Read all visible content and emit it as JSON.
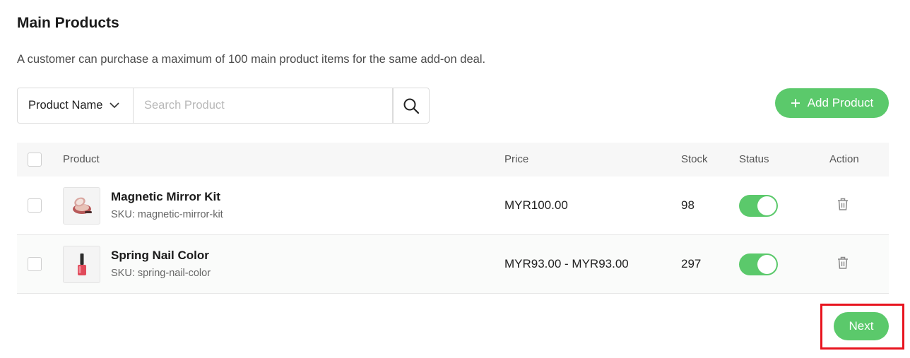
{
  "section": {
    "title": "Main Products",
    "description": "A customer can purchase a maximum of 100 main product items for the same add-on deal."
  },
  "search": {
    "field_selected": "Product Name",
    "placeholder": "Search Product",
    "value": ""
  },
  "add_button": {
    "icon": "plus-icon",
    "label": "Add Product"
  },
  "table": {
    "headers": {
      "product": "Product",
      "price": "Price",
      "stock": "Stock",
      "status": "Status",
      "action": "Action"
    },
    "rows": [
      {
        "name": "Magnetic Mirror Kit",
        "sku": "SKU: magnetic-mirror-kit",
        "price": "MYR100.00",
        "stock": "98",
        "status_on": true,
        "thumb_icon": "mirror-kit-image"
      },
      {
        "name": "Spring Nail Color",
        "sku": "SKU: spring-nail-color",
        "price": "MYR93.00 - MYR93.00",
        "stock": "297",
        "status_on": true,
        "thumb_icon": "nail-polish-image"
      }
    ]
  },
  "next_button": {
    "label": "Next"
  },
  "colors": {
    "accent": "#5bc96b",
    "highlight": "#e8141f"
  }
}
